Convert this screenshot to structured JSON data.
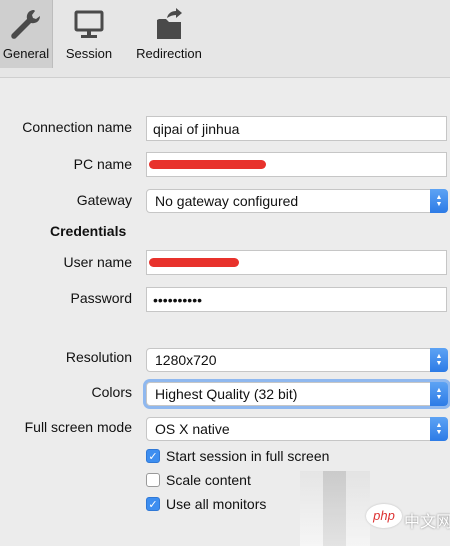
{
  "toolbar": {
    "tabs": [
      {
        "label": "General",
        "icon": "wrench-icon"
      },
      {
        "label": "Session",
        "icon": "monitor-icon"
      },
      {
        "label": "Redirection",
        "icon": "folder-share-icon"
      }
    ],
    "selected": "General"
  },
  "form": {
    "connection_name": {
      "label": "Connection name",
      "value": "qipai of jinhua"
    },
    "pc_name": {
      "label": "PC name"
    },
    "gateway": {
      "label": "Gateway",
      "value": "No gateway configured"
    },
    "credentials_title": "Credentials",
    "user_name": {
      "label": "User name"
    },
    "password": {
      "label": "Password",
      "value": "••••••••••"
    },
    "resolution": {
      "label": "Resolution",
      "value": "1280x720"
    },
    "colors": {
      "label": "Colors",
      "value": "Highest Quality (32 bit)"
    },
    "full_screen_mode": {
      "label": "Full screen mode",
      "value": "OS X native"
    },
    "checkboxes": [
      {
        "label": "Start session in full screen",
        "checked": true
      },
      {
        "label": "Scale content",
        "checked": false
      },
      {
        "label": "Use all monitors",
        "checked": true
      }
    ]
  },
  "watermark": {
    "logo": "php",
    "text": "中文网"
  },
  "colors": {
    "accent": "#3d8ef0",
    "redaction": "#e8322c"
  }
}
